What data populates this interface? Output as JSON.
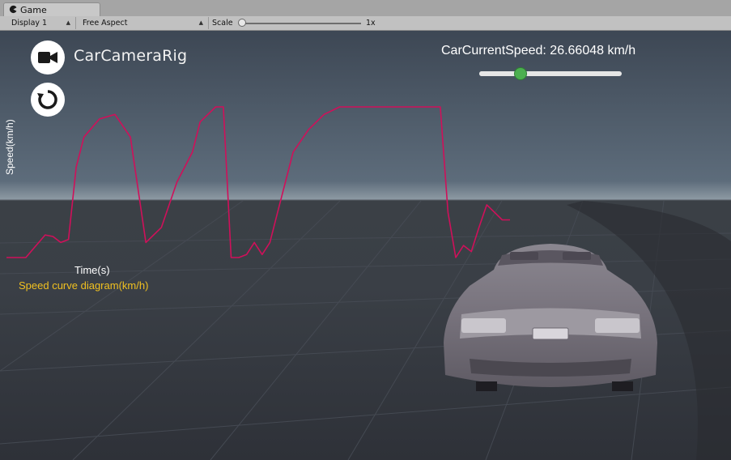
{
  "window": {
    "tab_label": "Game",
    "tab_icon": "pacman-game-icon"
  },
  "toolbar": {
    "display": "Display 1",
    "aspect": "Free Aspect",
    "scale_label": "Scale",
    "scale_value": "1x"
  },
  "overlay": {
    "rig_label": "CarCameraRig",
    "camera_icon": "video-camera-icon",
    "reset_icon": "reset-rotate-icon",
    "speed_text": "CarCurrentSpeed: 26.66048 km/h",
    "speed_slider_fraction": 0.29,
    "slider_thumb_color": "#4caf50"
  },
  "chart_data": {
    "type": "line",
    "title": "",
    "caption": "Speed curve diagram(km/h)",
    "xlabel": "Time(s)",
    "ylabel": "Speed(km/h)",
    "line_color": "#d0105a",
    "caption_color": "#f0c020",
    "grid": false,
    "ylim": [
      0,
      100
    ],
    "series": [
      {
        "x": [
          0,
          5,
          10,
          12,
          14,
          16,
          18,
          20,
          24,
          28,
          32,
          36,
          40,
          44,
          48,
          50,
          52,
          54,
          56,
          58,
          60,
          62,
          64,
          66,
          68,
          70,
          72,
          74,
          78,
          82,
          86,
          90,
          94,
          98,
          102,
          104,
          106,
          108,
          110,
          112,
          114,
          116,
          118,
          120,
          122,
          124,
          126,
          128,
          130
        ],
        "y": [
          0,
          0,
          15,
          14,
          10,
          12,
          60,
          80,
          92,
          95,
          80,
          10,
          20,
          50,
          70,
          90,
          95,
          100,
          100,
          0,
          0,
          2,
          10,
          2,
          10,
          30,
          50,
          70,
          85,
          95,
          100,
          100,
          100,
          100,
          100,
          100,
          100,
          100,
          100,
          100,
          30,
          0,
          8,
          4,
          20,
          35,
          30,
          25,
          25
        ]
      }
    ]
  }
}
